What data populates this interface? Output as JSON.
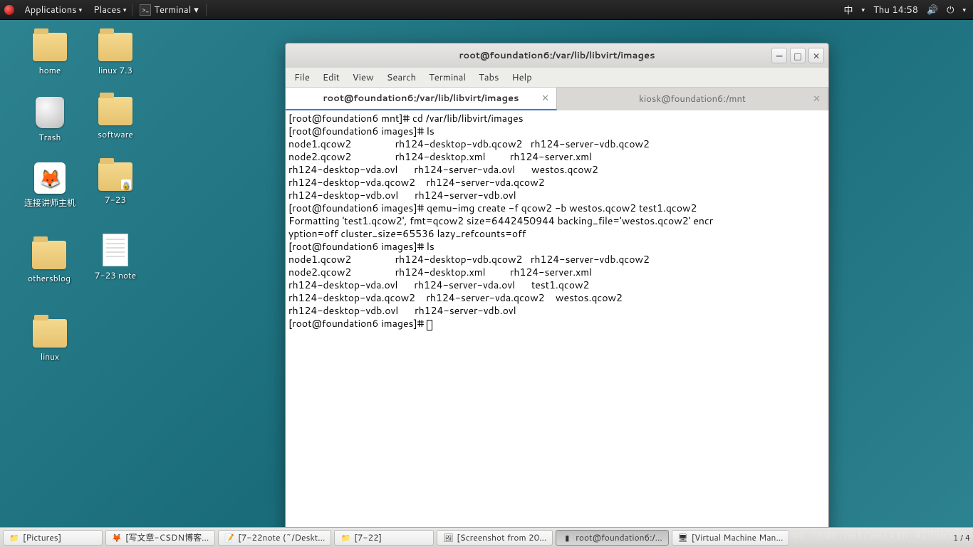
{
  "panel": {
    "applications": "Applications",
    "places": "Places",
    "terminal_task": "Terminal",
    "ime": "中",
    "clock": "Thu 14:58"
  },
  "desktop_icons": {
    "home": "home",
    "linux73": "linux 7.3",
    "trash": "Trash",
    "software": "software",
    "connect": "连接讲师主机",
    "d723": "7-23",
    "othersblog": "othersblog",
    "note723": "7-23 note",
    "linux": "linux"
  },
  "window": {
    "title": "root@foundation6:/var/lib/libvirt/images",
    "menus": {
      "file": "File",
      "edit": "Edit",
      "view": "View",
      "search": "Search",
      "terminal": "Terminal",
      "tabs": "Tabs",
      "help": "Help"
    },
    "tab1": "root@foundation6:/var/lib/libvirt/images",
    "tab2": "kiosk@foundation6:/mnt"
  },
  "terminal_lines": [
    "[root@foundation6 mnt]# cd /var/lib/libvirt/images",
    "[root@foundation6 images]# ls",
    "node1.qcow2                rh124-desktop-vdb.qcow2   rh124-server-vdb.qcow2",
    "node2.qcow2                rh124-desktop.xml         rh124-server.xml",
    "rh124-desktop-vda.ovl      rh124-server-vda.ovl      westos.qcow2",
    "rh124-desktop-vda.qcow2    rh124-server-vda.qcow2",
    "rh124-desktop-vdb.ovl      rh124-server-vdb.ovl",
    "[root@foundation6 images]# qemu-img create -f qcow2 -b westos.qcow2 test1.qcow2",
    "Formatting 'test1.qcow2', fmt=qcow2 size=6442450944 backing_file='westos.qcow2' encr",
    "yption=off cluster_size=65536 lazy_refcounts=off",
    "[root@foundation6 images]# ls",
    "node1.qcow2                rh124-desktop-vdb.qcow2   rh124-server-vdb.qcow2",
    "node2.qcow2                rh124-desktop.xml         rh124-server.xml",
    "rh124-desktop-vda.ovl      rh124-server-vda.ovl      test1.qcow2",
    "rh124-desktop-vda.qcow2    rh124-server-vda.qcow2    westos.qcow2",
    "rh124-desktop-vdb.ovl      rh124-server-vdb.ovl",
    "[root@foundation6 images]# "
  ],
  "taskbar": {
    "t1": "[Pictures]",
    "t2": "[写文章-CSDN博客...",
    "t3": "[7-22note (~/Deskt...",
    "t4": "[7-22]",
    "t5": "[Screenshot from 20...",
    "t6": "root@foundation6:/...",
    "t7": "[Virtual Machine Man...",
    "pager": "1 / 4"
  },
  "watermark": "https://blog.csdn.net/weixin_42996595"
}
